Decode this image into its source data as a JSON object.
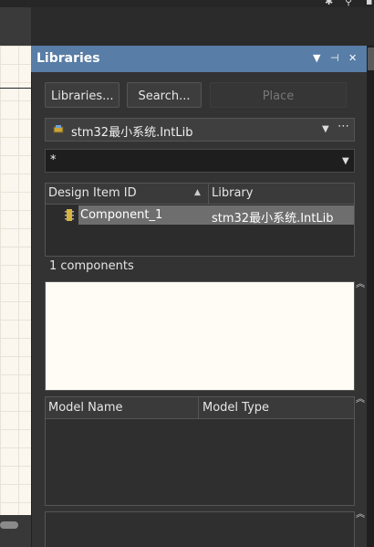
{
  "panel": {
    "title": "Libraries",
    "title_controls": [
      "menu-arrow-icon",
      "pin-icon",
      "close-icon"
    ]
  },
  "toolbar": {
    "libraries_label": "Libraries...",
    "search_label": "Search...",
    "place_label": "Place"
  },
  "library_select": {
    "value": "stm32最小系统.IntLib",
    "more_label": "⋯"
  },
  "filter": {
    "value": "*"
  },
  "components_table": {
    "columns": [
      "Design Item ID",
      "Library"
    ],
    "rows": [
      {
        "design_item_id": "Component_1",
        "library": "stm32最小系统.IntLib",
        "selected": true
      }
    ]
  },
  "component_count": "1 components",
  "model_table": {
    "columns": [
      "Model Name",
      "Model Type"
    ]
  },
  "colors": {
    "title_bar": "#587da6",
    "panel_bg": "#333333",
    "selection": "#6e6e6e",
    "preview_bg": "#fffcf5"
  }
}
